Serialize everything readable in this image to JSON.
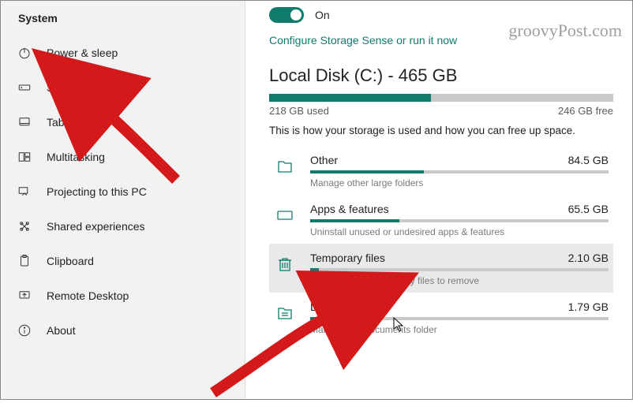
{
  "watermark": "groovyPost.com",
  "sidebar": {
    "title": "System",
    "items": [
      {
        "label": "Power & sleep"
      },
      {
        "label": "Storage"
      },
      {
        "label": "Tablet"
      },
      {
        "label": "Multitasking"
      },
      {
        "label": "Projecting to this PC"
      },
      {
        "label": "Shared experiences"
      },
      {
        "label": "Clipboard"
      },
      {
        "label": "Remote Desktop"
      },
      {
        "label": "About"
      }
    ]
  },
  "storage": {
    "toggle_state": "On",
    "configure_link": "Configure Storage Sense or run it now",
    "disk_title": "Local Disk (C:) - 465 GB",
    "used_text": "218 GB used",
    "free_text": "246 GB free",
    "used_percent": 47,
    "explain": "This is how your storage is used and how you can free up space.",
    "categories": [
      {
        "name": "Other",
        "size": "84.5 GB",
        "percent": 38,
        "desc": "Manage other large folders"
      },
      {
        "name": "Apps & features",
        "size": "65.5 GB",
        "percent": 30,
        "desc": "Uninstall unused or undesired apps & features"
      },
      {
        "name": "Temporary files",
        "size": "2.10 GB",
        "percent": 3,
        "desc": "Choose which temporary files to remove"
      },
      {
        "name": "Documents",
        "size": "1.79 GB",
        "percent": 3,
        "desc": "Manage the Documents folder"
      }
    ]
  }
}
